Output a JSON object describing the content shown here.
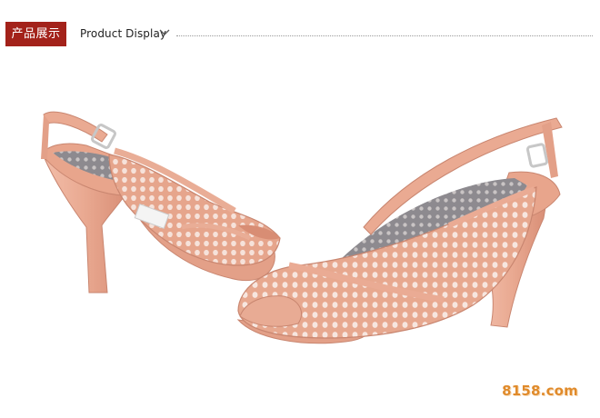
{
  "header": {
    "tag_label": "产品展示",
    "title": "Product Display",
    "accent_color": "#a3221a"
  },
  "product": {
    "image_alt": "Pink perforated peep-toe slingback platform high-heel sandals",
    "shoe_color": "#e9a991"
  },
  "watermark": {
    "text": "8158.com"
  }
}
